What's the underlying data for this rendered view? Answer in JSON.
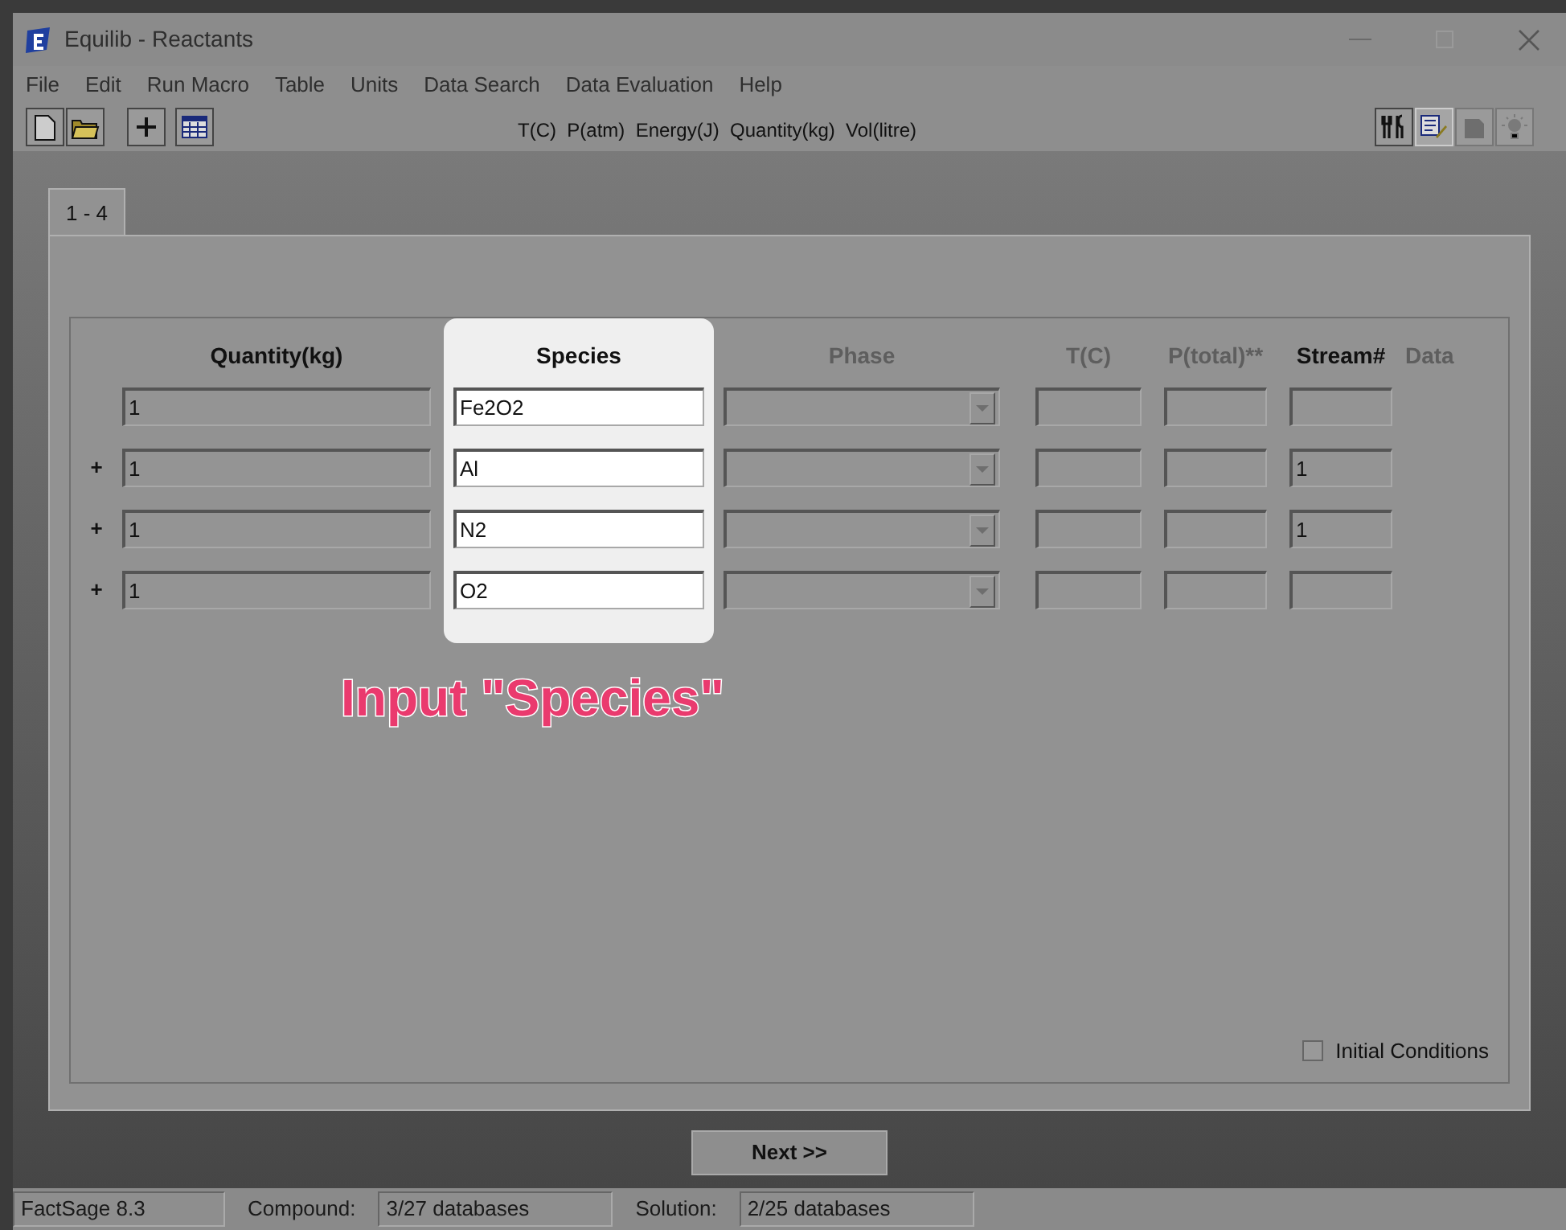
{
  "window": {
    "title": "Equilib - Reactants"
  },
  "menu": [
    "File",
    "Edit",
    "Run Macro",
    "Table",
    "Units",
    "Data Search",
    "Data Evaluation",
    "Help"
  ],
  "units_label": "T(C)  P(atm)  Energy(J)  Quantity(kg)  Vol(litre)",
  "tabs": [
    {
      "label": "1 - 4",
      "selected": true
    }
  ],
  "columns": [
    {
      "label": "Quantity(kg)",
      "disabled": false
    },
    {
      "label": "Species",
      "disabled": false
    },
    {
      "label": "Phase",
      "disabled": true
    },
    {
      "label": "T(C)",
      "disabled": true
    },
    {
      "label": "P(total)**",
      "disabled": true
    },
    {
      "label": "Stream#",
      "disabled": false
    },
    {
      "label": "Data",
      "disabled": true
    }
  ],
  "rows": [
    {
      "quantity": "1",
      "species": "Fe2O2"
    },
    {
      "plus": "+",
      "quantity": "1",
      "species": "Al",
      "stream": "1"
    },
    {
      "plus": "+",
      "quantity": "1",
      "species": "N2",
      "stream": "1"
    },
    {
      "plus": "+",
      "quantity": "1",
      "species": "O2"
    }
  ],
  "annotation": "Input \"Species\"",
  "initial_conditions": {
    "label": "Initial Conditions",
    "checked": false
  },
  "next_button": "Next >>",
  "status_bar": [
    {
      "kind": "field",
      "text": "FactSage 8.3"
    },
    {
      "kind": "label",
      "text": "Compound:"
    },
    {
      "kind": "field",
      "text": "3/27 databases"
    },
    {
      "kind": "label",
      "text": "Solution:"
    },
    {
      "kind": "field",
      "text": "2/25 databases"
    }
  ]
}
